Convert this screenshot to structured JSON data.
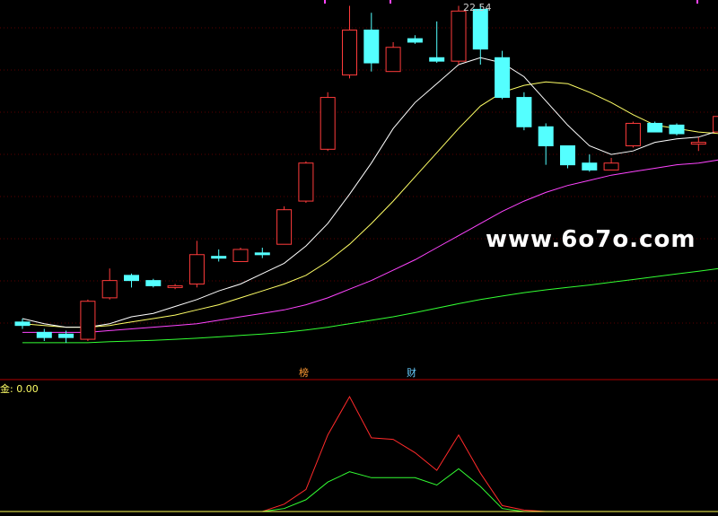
{
  "chart_data": [
    {
      "type": "candlestick",
      "title": "",
      "high_label": "22.54",
      "annotations": [
        "榜",
        "财"
      ],
      "watermark": "www.6o7o.com",
      "colors": {
        "up": "#ff3b3b",
        "down": "#54ffff",
        "ma5": "#ffffff",
        "ma10": "#ffff66",
        "ma20": "#ff44ff",
        "ma60": "#33ff33",
        "grid": "#5a0000"
      },
      "candles": [
        {
          "o": 13.35,
          "h": 13.45,
          "c": 13.25,
          "l": 13.15
        },
        {
          "o": 13.05,
          "h": 13.15,
          "c": 12.9,
          "l": 12.8
        },
        {
          "o": 13.0,
          "h": 13.1,
          "c": 12.9,
          "l": 12.75
        },
        {
          "o": 12.85,
          "h": 14.0,
          "c": 13.95,
          "l": 12.8
        },
        {
          "o": 14.05,
          "h": 14.9,
          "c": 14.55,
          "l": 14.0
        },
        {
          "o": 14.7,
          "h": 14.75,
          "c": 14.55,
          "l": 14.35
        },
        {
          "o": 14.55,
          "h": 14.6,
          "c": 14.4,
          "l": 14.35
        },
        {
          "o": 14.35,
          "h": 14.45,
          "c": 14.4,
          "l": 14.3
        },
        {
          "o": 14.45,
          "h": 15.7,
          "c": 15.3,
          "l": 14.35
        },
        {
          "o": 15.25,
          "h": 15.45,
          "c": 15.2,
          "l": 15.1
        },
        {
          "o": 15.1,
          "h": 15.5,
          "c": 15.45,
          "l": 15.1
        },
        {
          "o": 15.35,
          "h": 15.5,
          "c": 15.3,
          "l": 15.2
        },
        {
          "o": 15.6,
          "h": 16.7,
          "c": 16.6,
          "l": 15.6
        },
        {
          "o": 16.85,
          "h": 18.0,
          "c": 17.95,
          "l": 16.8
        },
        {
          "o": 18.35,
          "h": 20.0,
          "c": 19.85,
          "l": 18.3
        },
        {
          "o": 20.5,
          "h": 22.5,
          "c": 21.8,
          "l": 20.4
        },
        {
          "o": 21.8,
          "h": 22.3,
          "c": 20.85,
          "l": 20.6
        },
        {
          "o": 20.6,
          "h": 21.45,
          "c": 21.3,
          "l": 20.6
        },
        {
          "o": 21.55,
          "h": 21.65,
          "c": 21.45,
          "l": 21.4
        },
        {
          "o": 21.0,
          "h": 22.05,
          "c": 20.9,
          "l": 20.85
        },
        {
          "o": 20.9,
          "h": 22.5,
          "c": 22.35,
          "l": 20.8
        },
        {
          "o": 22.4,
          "h": 22.54,
          "c": 21.25,
          "l": 20.8
        },
        {
          "o": 21.0,
          "h": 21.2,
          "c": 19.85,
          "l": 19.8
        },
        {
          "o": 19.85,
          "h": 20.0,
          "c": 19.0,
          "l": 18.9
        },
        {
          "o": 19.0,
          "h": 19.1,
          "c": 18.45,
          "l": 17.9
        },
        {
          "o": 18.45,
          "h": 18.45,
          "c": 17.9,
          "l": 17.8
        },
        {
          "o": 17.95,
          "h": 18.2,
          "c": 17.75,
          "l": 17.7
        },
        {
          "o": 17.75,
          "h": 18.1,
          "c": 17.95,
          "l": 17.75
        },
        {
          "o": 18.45,
          "h": 19.15,
          "c": 19.1,
          "l": 18.4
        },
        {
          "o": 19.1,
          "h": 19.15,
          "c": 18.85,
          "l": 18.85
        },
        {
          "o": 19.05,
          "h": 19.1,
          "c": 18.8,
          "l": 18.75
        },
        {
          "o": 18.55,
          "h": 18.7,
          "c": 18.55,
          "l": 18.3
        },
        {
          "o": 18.85,
          "h": 19.8,
          "c": 19.3,
          "l": 18.35
        },
        {
          "o": 19.05,
          "h": 19.15,
          "c": 18.7,
          "l": 18.6
        }
      ],
      "ma5": [
        13.45,
        13.3,
        13.2,
        13.2,
        13.3,
        13.5,
        13.6,
        13.8,
        14.0,
        14.25,
        14.45,
        14.75,
        15.05,
        15.55,
        16.2,
        17.05,
        17.95,
        18.95,
        19.7,
        20.25,
        20.8,
        21.0,
        20.85,
        20.45,
        19.75,
        19.05,
        18.45,
        18.2,
        18.3,
        18.55,
        18.65,
        18.7,
        18.9,
        19.05
      ],
      "ma10": [
        13.3,
        13.25,
        13.2,
        13.2,
        13.25,
        13.35,
        13.45,
        13.55,
        13.7,
        13.85,
        14.05,
        14.25,
        14.45,
        14.7,
        15.1,
        15.6,
        16.2,
        16.85,
        17.55,
        18.25,
        18.95,
        19.6,
        20.0,
        20.2,
        20.3,
        20.25,
        20.0,
        19.7,
        19.35,
        19.05,
        18.95,
        18.85,
        18.8,
        18.8
      ],
      "ma20": [
        13.05,
        13.05,
        13.05,
        13.05,
        13.1,
        13.15,
        13.2,
        13.25,
        13.3,
        13.4,
        13.5,
        13.6,
        13.7,
        13.85,
        14.05,
        14.3,
        14.55,
        14.85,
        15.15,
        15.5,
        15.85,
        16.2,
        16.55,
        16.85,
        17.1,
        17.3,
        17.45,
        17.6,
        17.7,
        17.8,
        17.9,
        17.95,
        18.05,
        18.1
      ],
      "ma60": [
        12.75,
        12.75,
        12.75,
        12.75,
        12.78,
        12.8,
        12.82,
        12.85,
        12.88,
        12.92,
        12.96,
        13.0,
        13.05,
        13.12,
        13.2,
        13.3,
        13.4,
        13.5,
        13.62,
        13.75,
        13.88,
        14.0,
        14.1,
        14.2,
        14.28,
        14.35,
        14.42,
        14.5,
        14.58,
        14.66,
        14.74,
        14.82,
        14.9,
        14.98
      ]
    },
    {
      "type": "line",
      "indicator_label": "金: 0.00",
      "series": [
        {
          "color": "#ff2a2a",
          "values": [
            0,
            0,
            0,
            0,
            0,
            0,
            0,
            0,
            0,
            0,
            0,
            0,
            5,
            15,
            52,
            78,
            50,
            49,
            40,
            28,
            52,
            26,
            4,
            1,
            0,
            0,
            0,
            0,
            0,
            0,
            0,
            0,
            0,
            0
          ]
        },
        {
          "color": "#33ff33",
          "values": [
            0,
            0,
            0,
            0,
            0,
            0,
            0,
            0,
            0,
            0,
            0,
            0,
            2,
            8,
            20,
            27,
            23,
            23,
            23,
            18,
            29,
            17,
            2,
            0,
            0,
            0,
            0,
            0,
            0,
            0,
            0,
            0,
            0,
            0
          ]
        },
        {
          "color": "#ffff55",
          "values": [
            0,
            0,
            0,
            0,
            0,
            0,
            0,
            0,
            0,
            0,
            0,
            0,
            0,
            0,
            0,
            0,
            0,
            0,
            0,
            0,
            0,
            0,
            0,
            0,
            0,
            0,
            0,
            0,
            0,
            0,
            0,
            0,
            0,
            0
          ]
        }
      ]
    }
  ]
}
